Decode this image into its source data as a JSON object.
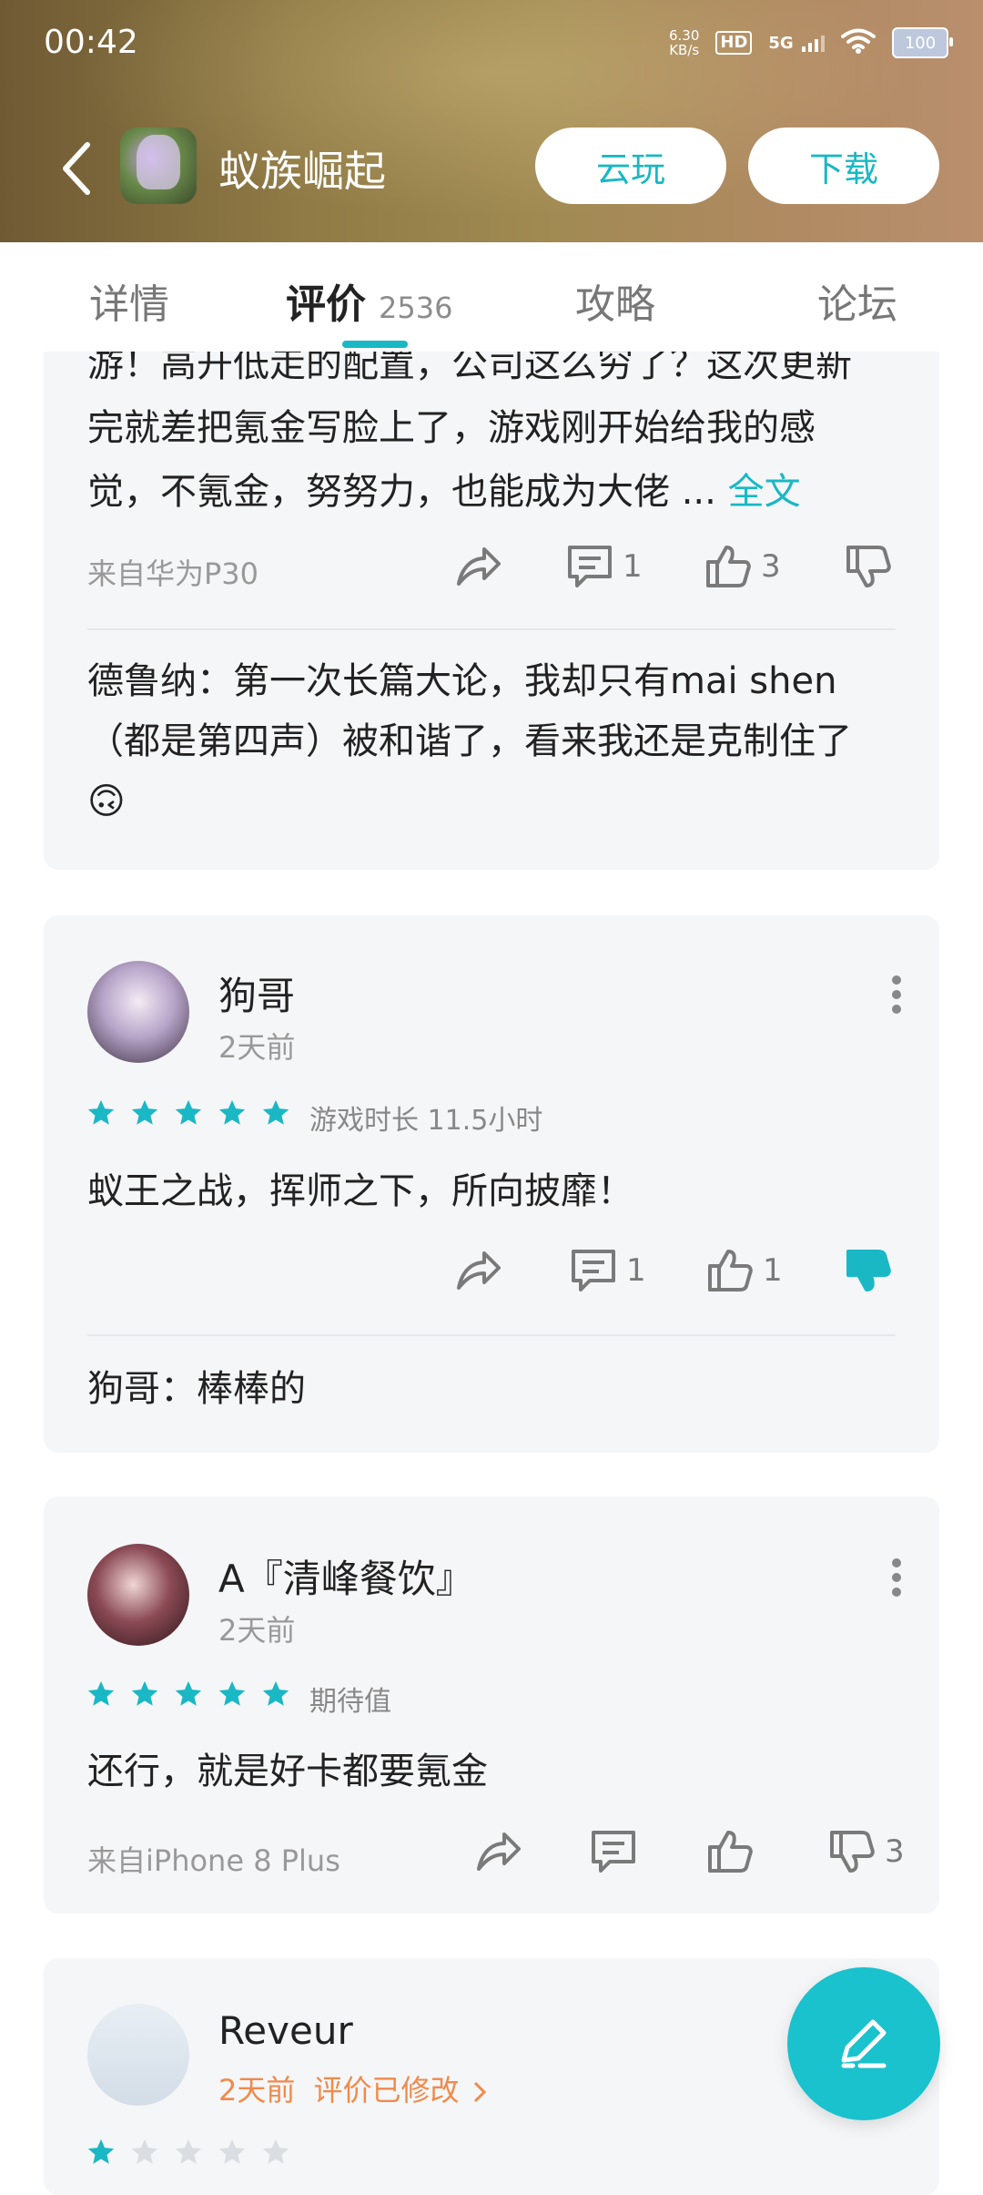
{
  "status": {
    "time": "00:42",
    "net_speed_top": "6.30",
    "net_speed_bottom": "KB/s",
    "hd": "HD",
    "network": "5G",
    "battery": "100"
  },
  "header": {
    "title": "蚁族崛起",
    "cloud_play": "云玩",
    "download": "下载"
  },
  "tabs": [
    {
      "label": "详情"
    },
    {
      "label": "评价",
      "count": "2536"
    },
    {
      "label": "攻略"
    },
    {
      "label": "论坛"
    }
  ],
  "reviews": [
    {
      "text_lines": [
        "游！高开低走的配置，公司这么穷了？这次更新",
        "完就差把氪金写脸上了，游戏刚开始给我的感",
        "觉，不氪金，努努力，也能成为大佬 ... "
      ],
      "more": "全文",
      "device": "来自华为P30",
      "comments": "1",
      "likes": "3",
      "reply_lines": [
        "德鲁纳：第一次长篇大论，我却只有mai shen",
        "（都是第四声）被和谐了，看来我还是克制住了",
        "🙃"
      ]
    },
    {
      "user": "狗哥",
      "time": "2天前",
      "rating": 5,
      "rating_note": "游戏时长 11.5小时",
      "text": "蚁王之战，挥师之下，所向披靡！",
      "comments": "1",
      "likes": "1",
      "reply": "狗哥：棒棒的"
    },
    {
      "user": "A『清峰餐饮』",
      "time": "2天前",
      "rating": 5,
      "rating_note": "期待值",
      "text": "还行，就是好卡都要氪金",
      "device": "来自iPhone 8 Plus",
      "dislikes": "3"
    },
    {
      "user": "Reveur",
      "time": "2天前",
      "edited": "评价已修改",
      "rating": 1
    }
  ],
  "colors": {
    "accent": "#19b8c4",
    "orange": "#f08a4b",
    "card_bg": "#f5f6f8"
  },
  "icons": [
    "back-icon",
    "share-icon",
    "comment-icon",
    "like-icon",
    "dislike-icon",
    "more-icon",
    "star-icon",
    "edit-icon"
  ]
}
